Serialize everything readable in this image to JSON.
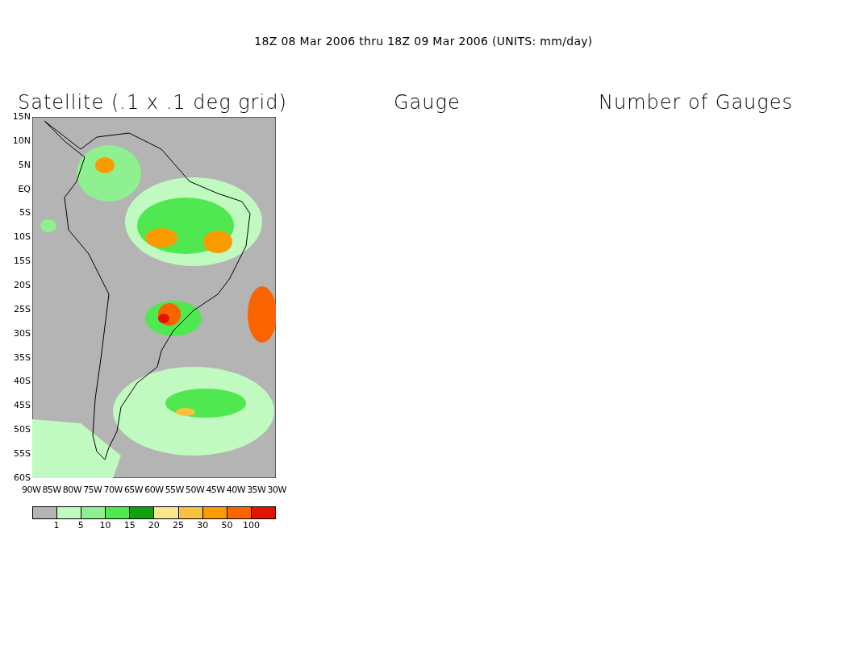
{
  "title": "18Z 08 Mar 2006 thru 18Z 09 Mar 2006 (UNITS: mm/day)",
  "panels": [
    {
      "kind": "map",
      "title": "Satellite (.1 x .1 deg grid)",
      "y_ticks": [
        "15N",
        "10N",
        "5N",
        "EQ",
        "5S",
        "10S",
        "15S",
        "20S",
        "25S",
        "30S",
        "35S",
        "40S",
        "45S",
        "50S",
        "55S",
        "60S"
      ],
      "x_ticks": [
        "90W",
        "85W",
        "80W",
        "75W",
        "70W",
        "65W",
        "60W",
        "55W",
        "50W",
        "45W",
        "40W",
        "35W",
        "30W"
      ],
      "legend": {
        "items": [
          {
            "color": "#b4b4b4"
          },
          {
            "color": "#c0fac0"
          },
          {
            "color": "#8ef08e"
          },
          {
            "color": "#50e850"
          },
          {
            "color": "#10a010"
          },
          {
            "color": "#fae68c"
          },
          {
            "color": "#fac040"
          },
          {
            "color": "#fa9c00"
          },
          {
            "color": "#fa6400"
          },
          {
            "color": "#e01400"
          }
        ],
        "labels": [
          "1",
          "5",
          "10",
          "15",
          "20",
          "25",
          "30",
          "50",
          "100"
        ]
      }
    },
    {
      "kind": "empty",
      "title": "Gauge"
    },
    {
      "kind": "empty",
      "title": "Number of Gauges"
    }
  ]
}
